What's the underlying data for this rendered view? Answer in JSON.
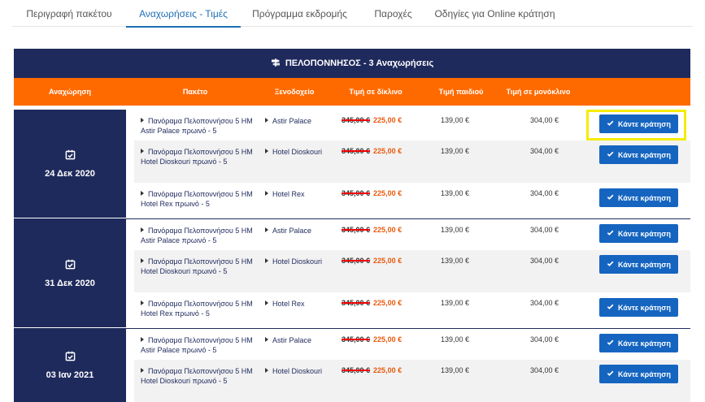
{
  "tabs": [
    {
      "label": "Περιγραφή πακέτου"
    },
    {
      "label": "Αναχωρήσεις - Τιμές"
    },
    {
      "label": "Πρόγραμμα εκδρομής"
    },
    {
      "label": "Παροχές"
    },
    {
      "label": "Οδηγίες για Online κράτηση"
    }
  ],
  "active_tab": 1,
  "table": {
    "title": "ΠΕΛΟΠΟΝΝΗΣΟΣ - 3 Αναχωρήσεις",
    "headers": {
      "departure": "Αναχώρηση",
      "package": "Πακέτο",
      "hotel": "Ξενοδοχείο",
      "double": "Τιμή σε δίκλινο",
      "child": "Τιμή παιδιού",
      "single": "Τιμή σε μονόκλινο"
    },
    "button_label": "Κάντε κράτηση",
    "departures": [
      {
        "date": "24 Δεκ 2020",
        "rows": [
          {
            "package": "Πανόραμα Πελοποννήσου 5 ΗΜ Astir Palace πρωινό - 5",
            "hotel": "Astir Palace",
            "old_price": "345,00 €",
            "new_price": "225,00 €",
            "child": "139,00 €",
            "single": "304,00 €"
          },
          {
            "package": "Πανόραμα Πελοποννήσου 5 ΗΜ Hotel Dioskouri πρωινό - 5",
            "hotel": "Hotel Dioskouri",
            "old_price": "345,00 €",
            "new_price": "225,00 €",
            "child": "139,00 €",
            "single": "304,00 €"
          },
          {
            "package": "Πανόραμα Πελοποννήσου 5 ΗΜ Hotel Rex πρωινό - 5",
            "hotel": "Hotel Rex",
            "old_price": "345,00 €",
            "new_price": "225,00 €",
            "child": "139,00 €",
            "single": "304,00 €"
          }
        ]
      },
      {
        "date": "31 Δεκ 2020",
        "rows": [
          {
            "package": "Πανόραμα Πελοποννήσου 5 ΗΜ Astir Palace πρωινό - 5",
            "hotel": "Astir Palace",
            "old_price": "345,00 €",
            "new_price": "225,00 €",
            "child": "139,00 €",
            "single": "304,00 €"
          },
          {
            "package": "Πανόραμα Πελοποννήσου 5 ΗΜ Hotel Dioskouri πρωινό - 5",
            "hotel": "Hotel Dioskouri",
            "old_price": "345,00 €",
            "new_price": "225,00 €",
            "child": "139,00 €",
            "single": "304,00 €"
          },
          {
            "package": "Πανόραμα Πελοποννήσου 5 ΗΜ Hotel Rex πρωινό - 5",
            "hotel": "Hotel Rex",
            "old_price": "345,00 €",
            "new_price": "225,00 €",
            "child": "139,00 €",
            "single": "304,00 €"
          }
        ]
      },
      {
        "date": "03 Ιαν 2021",
        "rows": [
          {
            "package": "Πανόραμα Πελοποννήσου 5 ΗΜ Astir Palace πρωινό - 5",
            "hotel": "Astir Palace",
            "old_price": "345,00 €",
            "new_price": "225,00 €",
            "child": "139,00 €",
            "single": "304,00 €"
          },
          {
            "package": "Πανόραμα Πελοποννήσου 5 ΗΜ Hotel Dioskouri πρωινό - 5",
            "hotel": "Hotel Dioskouri",
            "old_price": "345,00 €",
            "new_price": "225,00 €",
            "child": "139,00 €",
            "single": "304,00 €"
          }
        ]
      }
    ]
  },
  "colors": {
    "navy": "#1f2a5c",
    "orange": "#ff6a00",
    "button_blue": "#1565c0",
    "highlight_yellow": "#f5ec00",
    "new_price": "#e8590c"
  },
  "icons": {
    "title": "signpost-icon",
    "date": "calendar-check-icon",
    "button": "check-icon"
  }
}
